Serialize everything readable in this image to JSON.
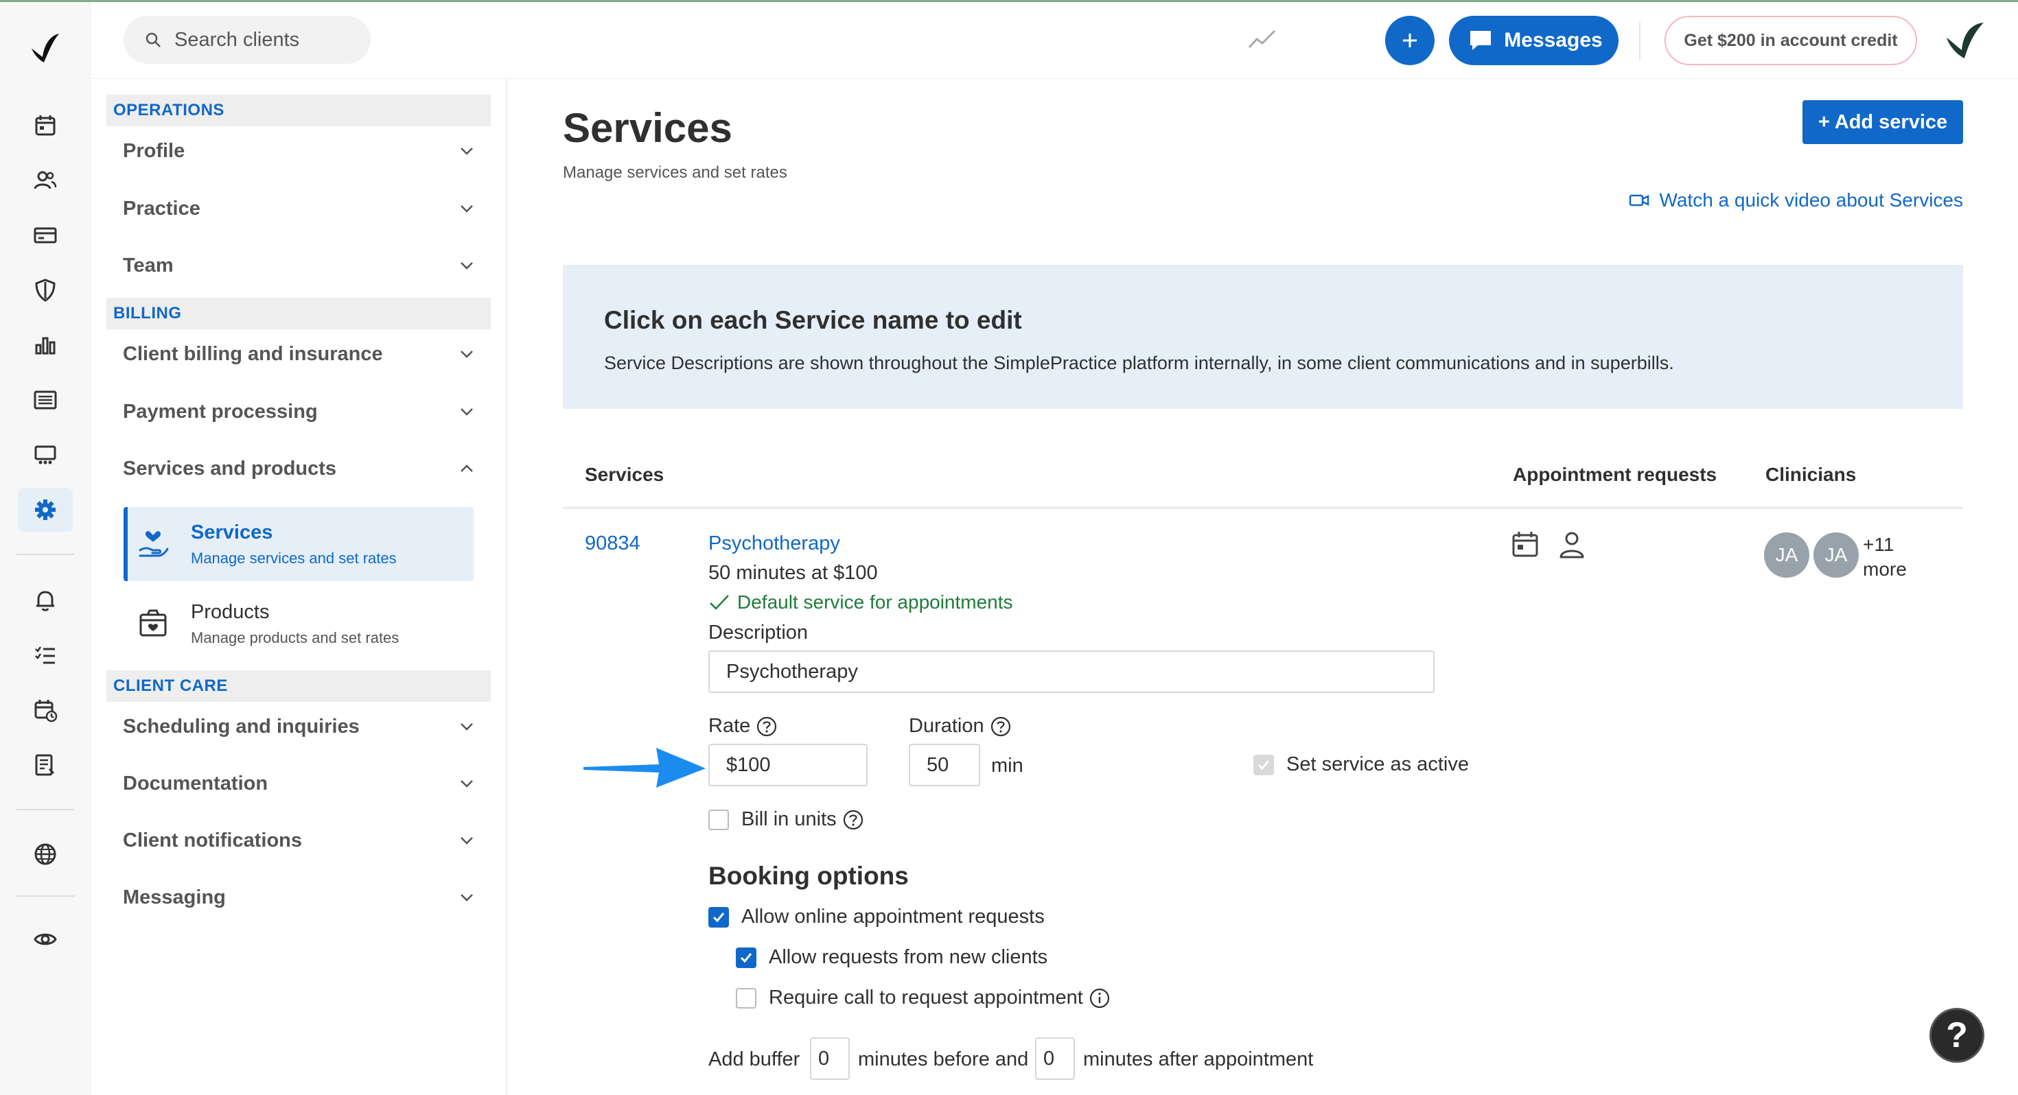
{
  "search": {
    "placeholder": "Search clients"
  },
  "header": {
    "messages_label": "Messages",
    "credit_label": "Get $200 in account credit",
    "accent_color": "#1068c9"
  },
  "rail": {
    "icons": [
      "logo-icon",
      "calendar-icon",
      "clients-icon",
      "billing-card-icon",
      "insurance-shield-icon",
      "analytics-icon",
      "activity-list-icon",
      "marketplace-icon",
      "settings-gear-icon",
      "notifications-bell-icon",
      "tasks-list-icon",
      "calendar-sync-icon",
      "reports-icon",
      "globe-icon",
      "eye-icon"
    ],
    "active": "settings-gear-icon"
  },
  "sidebar": {
    "sections": {
      "operations": "OPERATIONS",
      "billing": "BILLING",
      "client_care": "CLIENT CARE"
    },
    "items": {
      "profile": "Profile",
      "practice": "Practice",
      "team": "Team",
      "client_billing": "Client billing and insurance",
      "payment_processing": "Payment processing",
      "services_products": "Services and products",
      "scheduling": "Scheduling and inquiries",
      "documentation": "Documentation",
      "client_notifications": "Client notifications",
      "messaging": "Messaging"
    },
    "sub_items": {
      "services": {
        "title": "Services",
        "desc": "Manage services and set rates"
      },
      "products": {
        "title": "Products",
        "desc": "Manage products and set rates"
      }
    }
  },
  "main": {
    "title": "Services",
    "subtitle": "Manage services and set rates",
    "add_button": "+ Add service",
    "video_link": "Watch a quick video about Services",
    "banner": {
      "title": "Click on each Service name to edit",
      "text": "Service Descriptions are shown throughout the SimplePractice platform internally, in some client communications and in superbills."
    },
    "table_headers": {
      "services": "Services",
      "appointment_requests": "Appointment requests",
      "clinicians": "Clinicians"
    },
    "service": {
      "code": "90834",
      "name": "Psychotherapy",
      "summary": "50 minutes at $100",
      "default_text": "Default service for appointments",
      "description_label": "Description",
      "description_value": "Psychotherapy",
      "rate_label": "Rate",
      "rate_value": "$100",
      "duration_label": "Duration",
      "duration_value": "50",
      "duration_unit": "min",
      "active_label": "Set service as active",
      "bill_units_label": "Bill in units",
      "clinicians": [
        "JA",
        "JA"
      ],
      "more_count": "+11",
      "more_label": "more"
    },
    "booking": {
      "title": "Booking options",
      "allow_online": "Allow online appointment requests",
      "allow_new_clients": "Allow requests from new clients",
      "require_call": "Require call to request appointment",
      "buffer_prefix": "Add buffer",
      "buffer_before": "0",
      "buffer_middle": "minutes before and",
      "buffer_after": "0",
      "buffer_suffix": "minutes after appointment"
    }
  },
  "help_fab": "?"
}
